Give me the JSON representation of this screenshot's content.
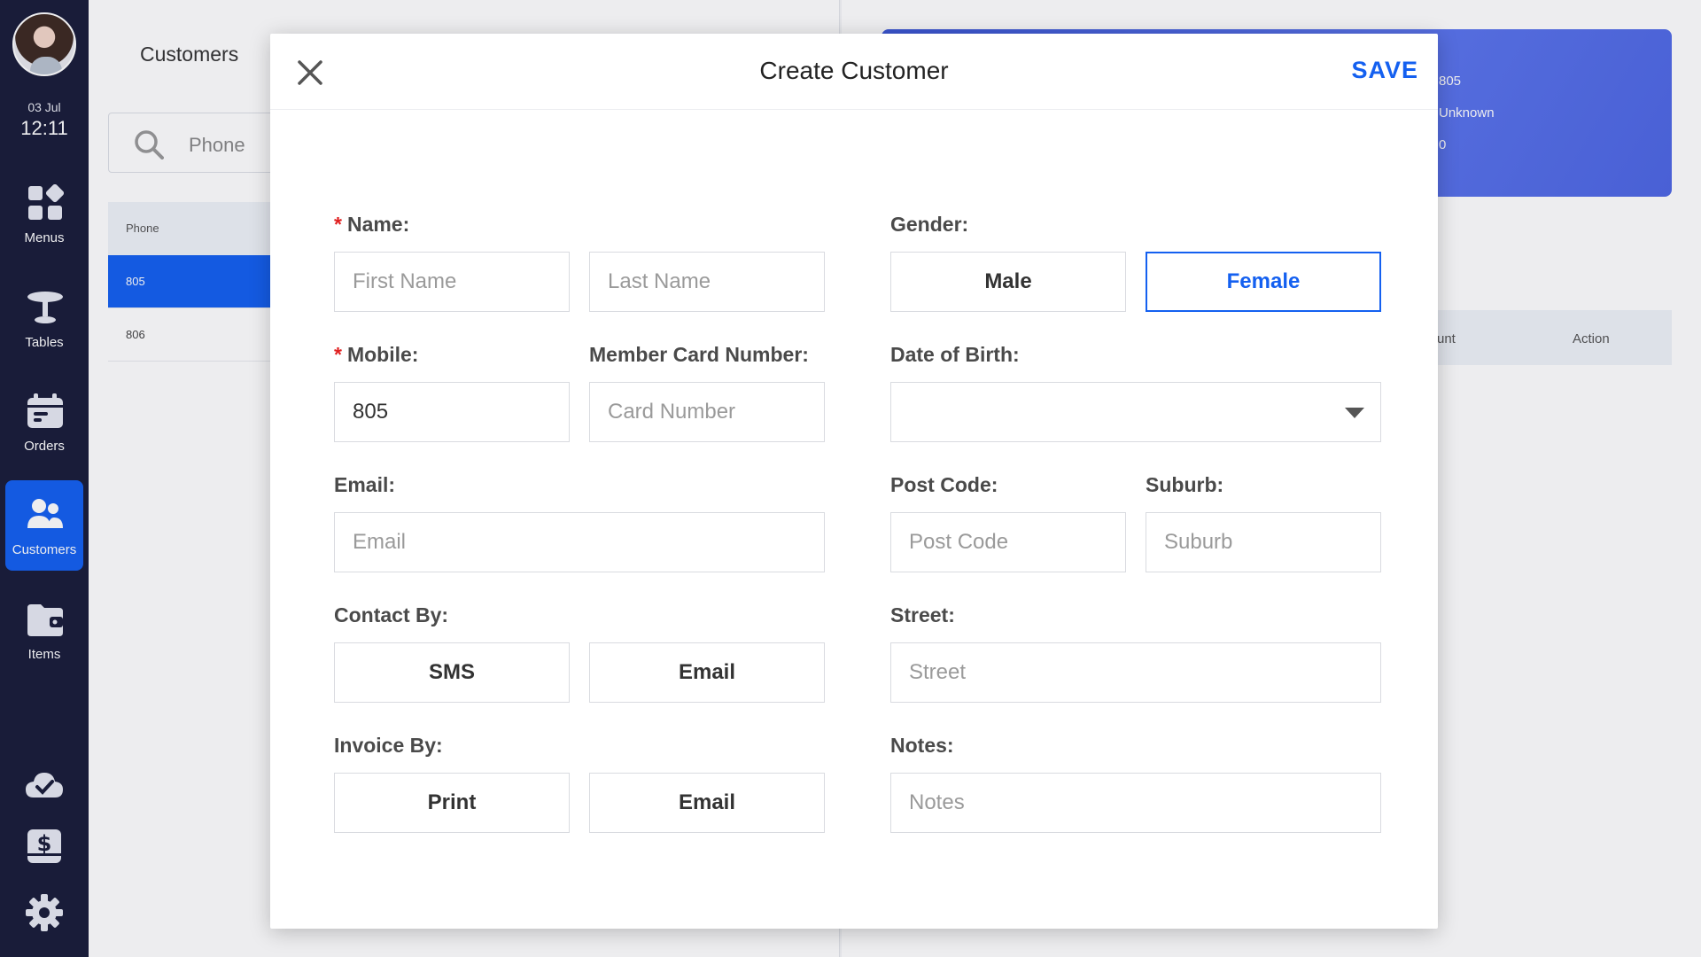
{
  "sidebar": {
    "date": "03 Jul",
    "time": "12:11",
    "items": [
      {
        "label": "Menus",
        "icon": "grid-icon"
      },
      {
        "label": "Tables",
        "icon": "table-icon"
      },
      {
        "label": "Orders",
        "icon": "orders-icon"
      },
      {
        "label": "Customers",
        "icon": "customers-icon"
      },
      {
        "label": "Items",
        "icon": "wallet-icon"
      }
    ],
    "utility_icons": [
      "cloud-check-icon",
      "cash-drawer-icon",
      "gear-icon"
    ],
    "accent_color": "#1460f0",
    "bg_color": "#191d3a"
  },
  "list": {
    "title": "Customers",
    "search_placeholder": "Phone",
    "column_header": "Phone",
    "rows": [
      "805",
      "806"
    ]
  },
  "detail": {
    "card_lines": [
      "805",
      "Unknown",
      "0"
    ],
    "table_headers": [
      "unt",
      "Action"
    ]
  },
  "modal": {
    "title": "Create Customer",
    "save_label": "SAVE",
    "name_label": "Name:",
    "first_name_placeholder": "First Name",
    "last_name_placeholder": "Last Name",
    "gender_label": "Gender:",
    "gender_options": [
      "Male",
      "Female"
    ],
    "gender_selected": "Female",
    "mobile_label": "Mobile:",
    "mobile_value": "805",
    "member_card_label": "Member Card Number:",
    "card_placeholder": "Card Number",
    "dob_label": "Date of Birth:",
    "dob_value": "",
    "email_label": "Email:",
    "email_placeholder": "Email",
    "post_code_label": "Post Code:",
    "post_code_placeholder": "Post Code",
    "suburb_label": "Suburb:",
    "suburb_placeholder": "Suburb",
    "contact_by_label": "Contact By:",
    "contact_options": [
      "SMS",
      "Email"
    ],
    "street_label": "Street:",
    "street_placeholder": "Street",
    "invoice_by_label": "Invoice By:",
    "invoice_options": [
      "Print",
      "Email"
    ],
    "notes_label": "Notes:",
    "notes_placeholder": "Notes",
    "required_marker": "*"
  }
}
